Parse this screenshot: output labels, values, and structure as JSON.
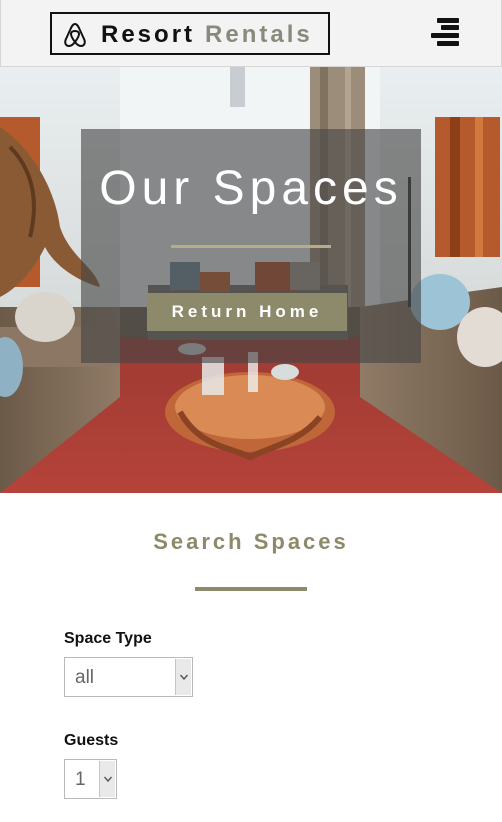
{
  "header": {
    "logo_word_1": "Resort",
    "logo_word_2": "Rentals",
    "menu_icon": "hamburger-icon"
  },
  "hero": {
    "title": "Our Spaces",
    "button_label": "Return Home"
  },
  "search": {
    "title": "Search Spaces",
    "fields": [
      {
        "label": "Space Type",
        "value": "all"
      },
      {
        "label": "Guests",
        "value": "1"
      }
    ]
  },
  "colors": {
    "accent": "#8c8a6a",
    "header_bg": "#f3f3f3",
    "overlay": "#464646"
  }
}
